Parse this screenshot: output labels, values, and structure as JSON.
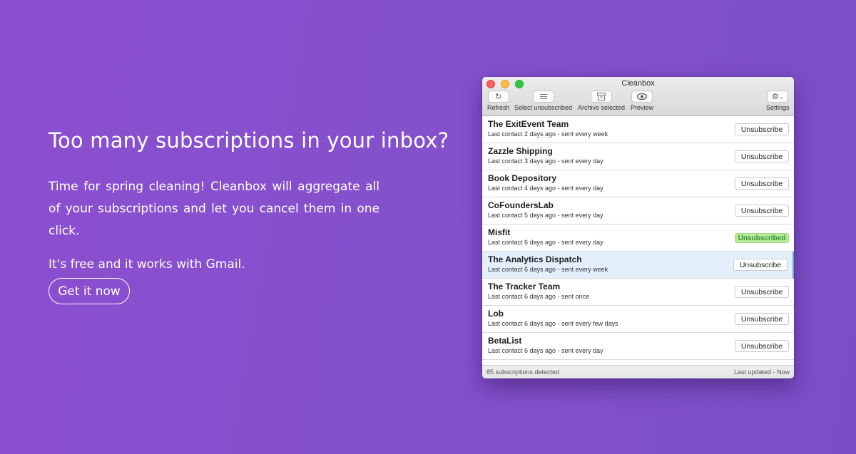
{
  "hero": {
    "heading": "Too many subscriptions in your inbox?",
    "lead": "Time for spring cleaning! Cleanbox will aggregate all of your subscriptions and let you cancel them in one click.",
    "free": "It's free and it works with Gmail.",
    "cta": "Get it now"
  },
  "window": {
    "title": "Cleanbox",
    "toolbar": {
      "refresh": "Refresh",
      "select_unsubscribed": "Select unsubscribed",
      "archive_selected": "Archive selected",
      "preview": "Preview",
      "settings": "Settings"
    },
    "rows": [
      {
        "name": "The ExitEvent Team",
        "detail": "Last contact 2 days ago - sent every week",
        "action": "Unsubscribe"
      },
      {
        "name": "Zazzle Shipping",
        "detail": "Last contact 3 days ago - sent every day",
        "action": "Unsubscribe"
      },
      {
        "name": "Book Depository",
        "detail": "Last contact 4 days ago - sent every day",
        "action": "Unsubscribe"
      },
      {
        "name": "CoFoundersLab",
        "detail": "Last contact 5 days ago - sent every day",
        "action": "Unsubscribe"
      },
      {
        "name": "Misfit",
        "detail": "Last contact 6 days ago - sent every day",
        "action": "Unsubscribed"
      },
      {
        "name": "The Analytics Dispatch",
        "detail": "Last contact 6 days ago - sent every week",
        "action": "Unsubscribe"
      },
      {
        "name": "The Tracker Team",
        "detail": "Last contact 6 days ago - sent once",
        "action": "Unsubscribe"
      },
      {
        "name": "Lob",
        "detail": "Last contact 6 days ago - sent every few days",
        "action": "Unsubscribe"
      },
      {
        "name": "BetaList",
        "detail": "Last contact 6 days ago - sent every day",
        "action": "Unsubscribe"
      }
    ],
    "status": {
      "count": "85 subscriptions detected",
      "updated": "Last updated - Now"
    }
  }
}
